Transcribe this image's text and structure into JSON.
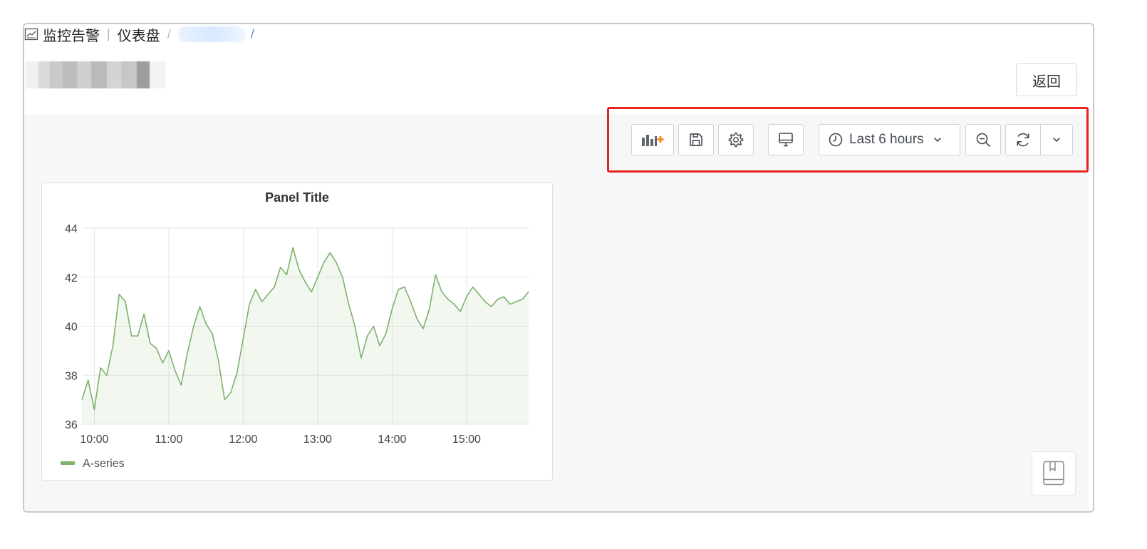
{
  "breadcrumb": {
    "items": [
      "监控告警",
      "仪表盘"
    ],
    "separator": "/",
    "trailing_separator": "/",
    "icon": "monitor-chart-icon"
  },
  "header": {
    "back_label": "返回"
  },
  "toolbar": {
    "add_panel_icon": "add-panel-icon",
    "save_icon": "save-icon",
    "settings_icon": "gear-icon",
    "cycle_view_icon": "monitor-icon",
    "time_range_label": "Last 6 hours",
    "time_icon": "clock-icon",
    "zoom_out_icon": "zoom-out-icon",
    "refresh_icon": "refresh-icon",
    "refresh_menu_icon": "chevron-down-icon",
    "highlight_color": "#e8231b",
    "accent_color": "#f58a1f"
  },
  "panel": {
    "title": "Panel Title"
  },
  "chart_data": {
    "type": "area",
    "title": "Panel Title",
    "xlabel": "",
    "ylabel": "",
    "x_ticks": [
      "10:00",
      "11:00",
      "12:00",
      "13:00",
      "14:00",
      "15:00"
    ],
    "y_ticks": [
      "36",
      "38",
      "40",
      "42",
      "44"
    ],
    "ylim": [
      36,
      44
    ],
    "x_range": [
      "09:50",
      "15:50"
    ],
    "grid": true,
    "legend": "bottom-left",
    "series": [
      {
        "name": "A-series",
        "color": "#7eb26d",
        "x": [
          "09:50",
          "09:55",
          "10:00",
          "10:05",
          "10:10",
          "10:15",
          "10:20",
          "10:25",
          "10:30",
          "10:35",
          "10:40",
          "10:45",
          "10:50",
          "10:55",
          "11:00",
          "11:05",
          "11:10",
          "11:15",
          "11:20",
          "11:25",
          "11:30",
          "11:35",
          "11:40",
          "11:45",
          "11:50",
          "11:55",
          "12:00",
          "12:05",
          "12:10",
          "12:15",
          "12:20",
          "12:25",
          "12:30",
          "12:35",
          "12:40",
          "12:45",
          "12:50",
          "12:55",
          "13:00",
          "13:05",
          "13:10",
          "13:15",
          "13:20",
          "13:25",
          "13:30",
          "13:35",
          "13:40",
          "13:45",
          "13:50",
          "13:55",
          "14:00",
          "14:05",
          "14:10",
          "14:15",
          "14:20",
          "14:25",
          "14:30",
          "14:35",
          "14:40",
          "14:45",
          "14:50",
          "14:55",
          "15:00",
          "15:05",
          "15:10",
          "15:15",
          "15:20",
          "15:25",
          "15:30",
          "15:35",
          "15:40",
          "15:45",
          "15:50"
        ],
        "values": [
          37.0,
          37.8,
          36.6,
          38.3,
          38.0,
          39.2,
          41.3,
          41.0,
          39.6,
          39.6,
          40.5,
          39.3,
          39.1,
          38.5,
          39.0,
          38.2,
          37.6,
          38.9,
          40.0,
          40.8,
          40.1,
          39.7,
          38.6,
          37.0,
          37.3,
          38.1,
          39.5,
          40.9,
          41.5,
          41.0,
          41.3,
          41.6,
          42.4,
          42.1,
          43.2,
          42.3,
          41.8,
          41.4,
          42.0,
          42.6,
          43.0,
          42.6,
          42.0,
          40.9,
          40.0,
          38.7,
          39.6,
          40.0,
          39.2,
          39.7,
          40.7,
          41.5,
          41.6,
          41.0,
          40.3,
          39.9,
          40.7,
          42.1,
          41.4,
          41.1,
          40.9,
          40.6,
          41.2,
          41.6,
          41.3,
          41.0,
          40.8,
          41.1,
          41.2,
          40.9,
          41.0,
          41.1,
          41.4
        ]
      }
    ]
  },
  "help": {
    "icon": "book-icon"
  }
}
